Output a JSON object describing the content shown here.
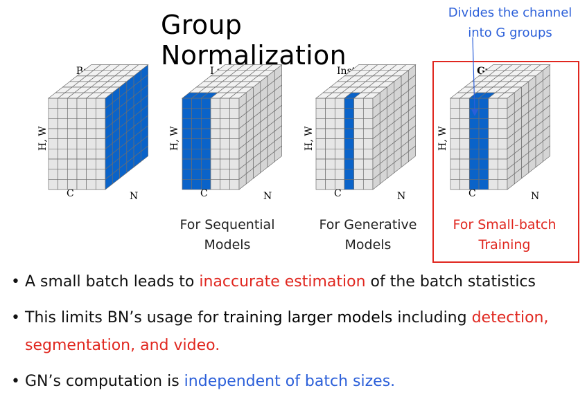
{
  "title": "Group Normalization",
  "annotation": {
    "line1": "Divides the channel",
    "line2": "into G groups",
    "color": "#2b5fd9"
  },
  "panels": [
    {
      "title": "Batch Norm",
      "axis_hw": "H, W",
      "axis_c": "C",
      "axis_n": "N",
      "caption1": "",
      "caption2": ""
    },
    {
      "title": "Layer Norm",
      "axis_hw": "H, W",
      "axis_c": "C",
      "axis_n": "N",
      "caption1": "For Sequential",
      "caption2": "Models"
    },
    {
      "title": "Instance Norm",
      "axis_hw": "H, W",
      "axis_c": "C",
      "axis_n": "N",
      "caption1": "For Generative",
      "caption2": "Models"
    },
    {
      "title": "Group Norm",
      "axis_hw": "H, W",
      "axis_c": "C",
      "axis_n": "N",
      "caption1": "For Small-batch",
      "caption2": "Training"
    }
  ],
  "bullets": {
    "b1": {
      "pre": "A small batch leads to ",
      "hl": "inaccurate estimation",
      "post": " of the batch statistics"
    },
    "b2": {
      "pre": "This limits BN’s usage for ",
      "strong": "training larger models",
      "mid": " including ",
      "hl1": "detection,",
      "hl2": "segmentation, and video."
    },
    "b3": {
      "pre": "GN’s computation is ",
      "hl": "independent of batch sizes."
    }
  },
  "colors": {
    "highlight_blue": "#0a63c9",
    "cube_top": "#f2f2f2",
    "cube_front": "#e6e6e6",
    "cube_side": "#d5d5d5",
    "accent_red": "#e0271f"
  }
}
